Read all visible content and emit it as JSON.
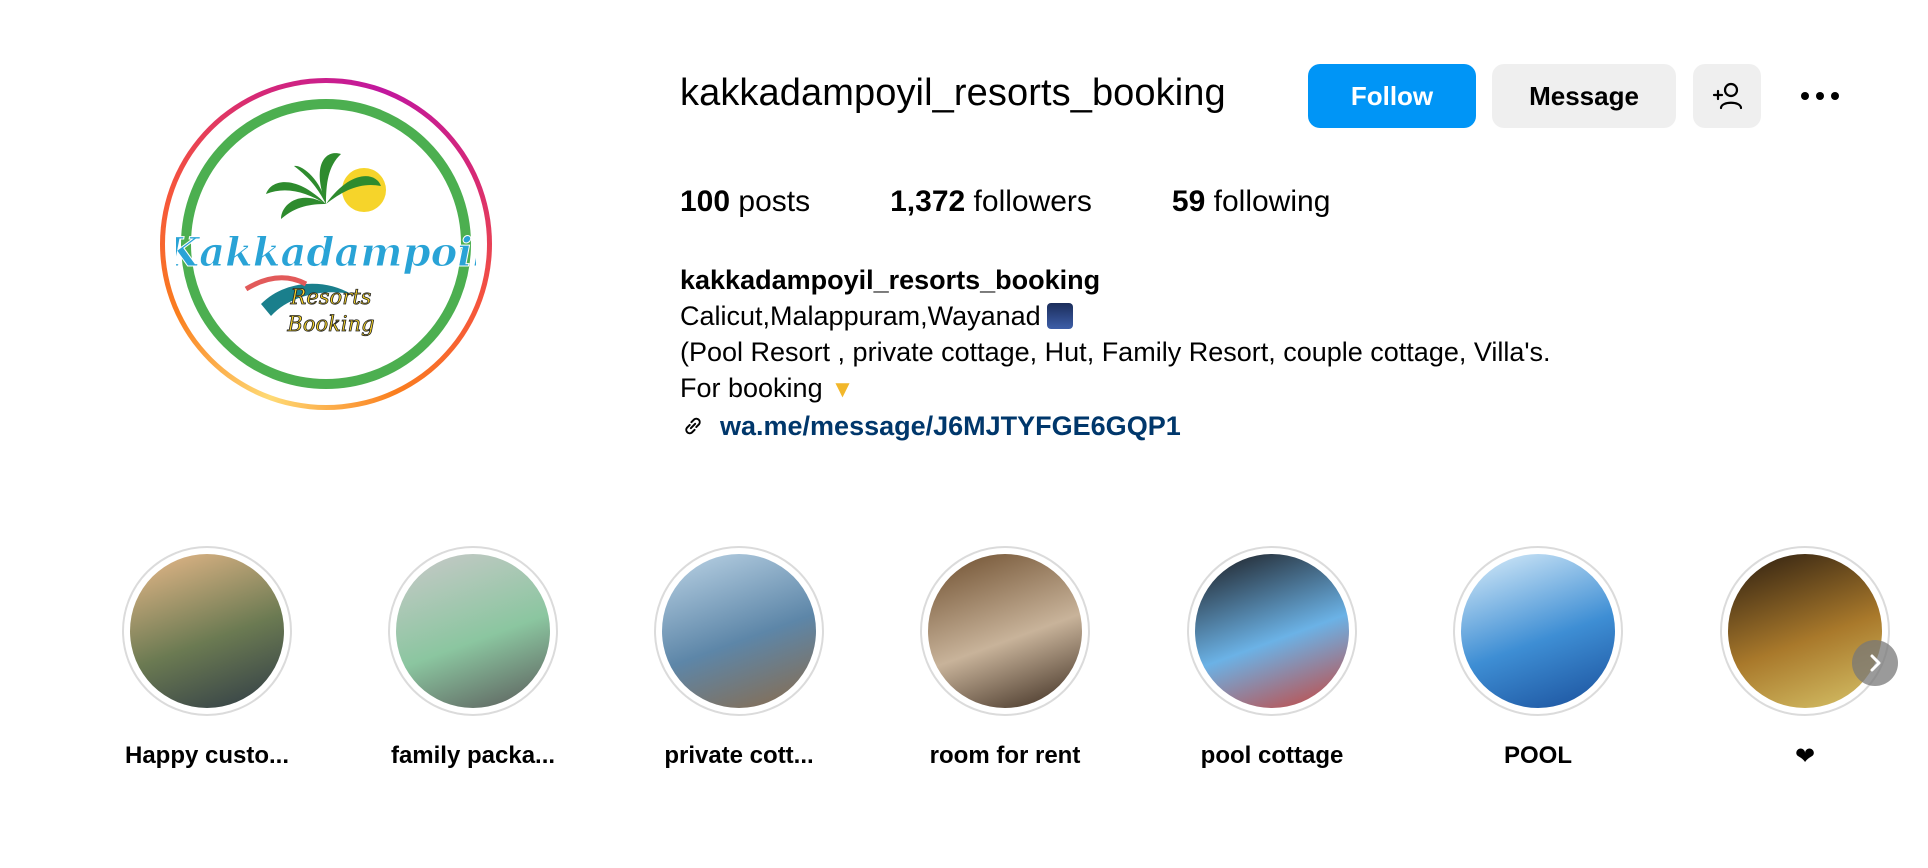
{
  "profile": {
    "username": "kakkadampoyil_resorts_booking",
    "avatar_logo": {
      "title": "Kakkadampoil",
      "line2": "Resorts",
      "line3": "Booking"
    },
    "buttons": {
      "follow": "Follow",
      "message": "Message",
      "add_user_icon": "add-user-icon",
      "more_icon": "more-options-icon"
    },
    "stats": {
      "posts_count": "100",
      "posts_label": "posts",
      "followers_count": "1,372",
      "followers_label": "followers",
      "following_count": "59",
      "following_label": "following"
    },
    "bio": {
      "name": "kakkadampoyil_resorts_booking",
      "line1": "Calicut,Malappuram,Wayanad",
      "line2": "(Pool Resort , private cottage, Hut, Family Resort, couple cottage, Villa's.",
      "line3": "For booking",
      "link": "wa.me/message/J6MJTYFGE6GQP1"
    }
  },
  "highlights": [
    {
      "label": "Happy custo...",
      "colors": [
        "#e9b98a",
        "#6b7a52",
        "#2f3b46"
      ]
    },
    {
      "label": "family packa...",
      "colors": [
        "#c9c9c9",
        "#8bc6a0",
        "#5a5a5a"
      ]
    },
    {
      "label": "private cott...",
      "colors": [
        "#bcd4e6",
        "#5d86a8",
        "#8b6b4a"
      ]
    },
    {
      "label": "room for rent",
      "colors": [
        "#6e4e2e",
        "#c8b39a",
        "#3a2a1e"
      ]
    },
    {
      "label": "pool cottage",
      "colors": [
        "#1b1b1f",
        "#6bb2e6",
        "#c9433a"
      ]
    },
    {
      "label": "POOL",
      "colors": [
        "#dbeefa",
        "#3e8ed4",
        "#1a4f9b"
      ]
    },
    {
      "label": "❤",
      "colors": [
        "#2b1d10",
        "#a9792b",
        "#d7c46a"
      ]
    }
  ]
}
